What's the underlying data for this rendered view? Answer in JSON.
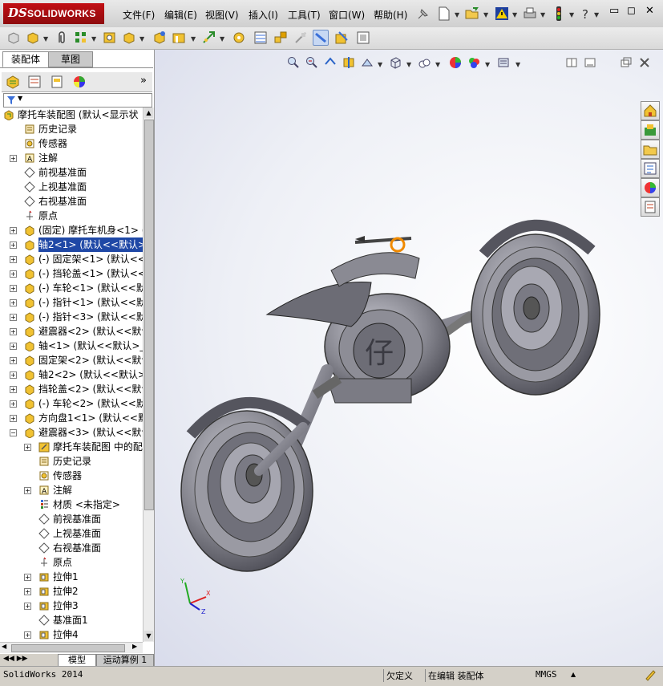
{
  "app": {
    "logo_mark": "DS",
    "logo_text": "SOLIDWORKS",
    "version_text": "SolidWorks 2014"
  },
  "menu": [
    {
      "label": "文件(F)"
    },
    {
      "label": "编辑(E)"
    },
    {
      "label": "视图(V)"
    },
    {
      "label": "插入(I)"
    },
    {
      "label": "工具(T)"
    },
    {
      "label": "窗口(W)"
    },
    {
      "label": "帮助(H)"
    }
  ],
  "window_controls": {
    "minimize": "▭",
    "restore": "◻",
    "close": "✕"
  },
  "panel": {
    "tabs": [
      {
        "label": "装配体"
      },
      {
        "label": "草图"
      }
    ],
    "more": "»",
    "filter_icon": "filter-icon",
    "bottom_tabs": [
      {
        "label": "模型"
      },
      {
        "label": "运动算例 1"
      }
    ]
  },
  "tree": [
    {
      "label": "摩托车装配图  (默认<显示状",
      "icon": "assembly-icon",
      "level": 0
    },
    {
      "label": "历史记录",
      "icon": "history-icon",
      "level": 1
    },
    {
      "label": "传感器",
      "icon": "sensor-icon",
      "level": 1
    },
    {
      "label": "注解",
      "icon": "annotation-icon",
      "level": 1,
      "exp": "+"
    },
    {
      "label": "前视基准面",
      "icon": "plane-icon",
      "level": 1
    },
    {
      "label": "上视基准面",
      "icon": "plane-icon",
      "level": 1
    },
    {
      "label": "右视基准面",
      "icon": "plane-icon",
      "level": 1
    },
    {
      "label": "原点",
      "icon": "origin-icon",
      "level": 1
    },
    {
      "label": "(固定) 摩托车机身<1> (",
      "icon": "part-icon",
      "level": 1,
      "exp": "+"
    },
    {
      "label": "轴2<1> (默认<<默认>_显",
      "icon": "part-icon",
      "level": 1,
      "exp": "+",
      "selected": true
    },
    {
      "label": "(-) 固定架<1> (默认<<默",
      "icon": "part-icon",
      "level": 1,
      "exp": "+"
    },
    {
      "label": "(-) 挡轮盖<1> (默认<<默",
      "icon": "part-icon",
      "level": 1,
      "exp": "+"
    },
    {
      "label": "(-) 车轮<1> (默认<<默认",
      "icon": "part-icon",
      "level": 1,
      "exp": "+"
    },
    {
      "label": "(-) 指针<1> (默认<<默认",
      "icon": "part-icon",
      "level": 1,
      "exp": "+"
    },
    {
      "label": "(-) 指针<3> (默认<<默认",
      "icon": "part-icon",
      "level": 1,
      "exp": "+"
    },
    {
      "label": "避震器<2> (默认<<默认",
      "icon": "part-icon",
      "level": 1,
      "exp": "+"
    },
    {
      "label": "轴<1> (默认<<默认>_外观",
      "icon": "part-icon",
      "level": 1,
      "exp": "+"
    },
    {
      "label": "固定架<2> (默认<<默认>",
      "icon": "part-icon",
      "level": 1,
      "exp": "+"
    },
    {
      "label": "轴2<2> (默认<<默认>_显",
      "icon": "part-icon",
      "level": 1,
      "exp": "+"
    },
    {
      "label": "挡轮盖<2> (默认<<默认>",
      "icon": "part-icon",
      "level": 1,
      "exp": "+"
    },
    {
      "label": "(-) 车轮<2> (默认<<默认",
      "icon": "part-icon",
      "level": 1,
      "exp": "+"
    },
    {
      "label": "方向盘1<1> (默认<<默认",
      "icon": "part-icon",
      "level": 1,
      "exp": "+"
    },
    {
      "label": "避震器<3> (默认<<默认>",
      "icon": "part-icon",
      "level": 1,
      "exp": "−"
    },
    {
      "label": "摩托车装配图 中的配",
      "icon": "mate-icon",
      "level": 2,
      "exp": "+"
    },
    {
      "label": "历史记录",
      "icon": "history-icon",
      "level": 2
    },
    {
      "label": "传感器",
      "icon": "sensor-icon",
      "level": 2
    },
    {
      "label": "注解",
      "icon": "annotation-icon",
      "level": 2,
      "exp": "+"
    },
    {
      "label": "材质 <未指定>",
      "icon": "material-icon",
      "level": 2
    },
    {
      "label": "前视基准面",
      "icon": "plane-icon",
      "level": 2
    },
    {
      "label": "上视基准面",
      "icon": "plane-icon",
      "level": 2
    },
    {
      "label": "右视基准面",
      "icon": "plane-icon",
      "level": 2
    },
    {
      "label": "原点",
      "icon": "origin-icon",
      "level": 2
    },
    {
      "label": "拉伸1",
      "icon": "extrude-icon",
      "level": 2,
      "exp": "+"
    },
    {
      "label": "拉伸2",
      "icon": "extrude-icon",
      "level": 2,
      "exp": "+"
    },
    {
      "label": "拉伸3",
      "icon": "extrude-icon",
      "level": 2,
      "exp": "+"
    },
    {
      "label": "基准面1",
      "icon": "plane-icon",
      "level": 2
    },
    {
      "label": "拉伸4",
      "icon": "extrude-icon",
      "level": 2,
      "exp": "+"
    }
  ],
  "viewport": {
    "triad": {
      "x": "X",
      "y": "Y",
      "z": "Z"
    },
    "nameplate_char": "仔"
  },
  "status": {
    "app": "SolidWorks 2014",
    "state": "欠定义",
    "mode": "在编辑 装配体",
    "units": "MMGS"
  }
}
